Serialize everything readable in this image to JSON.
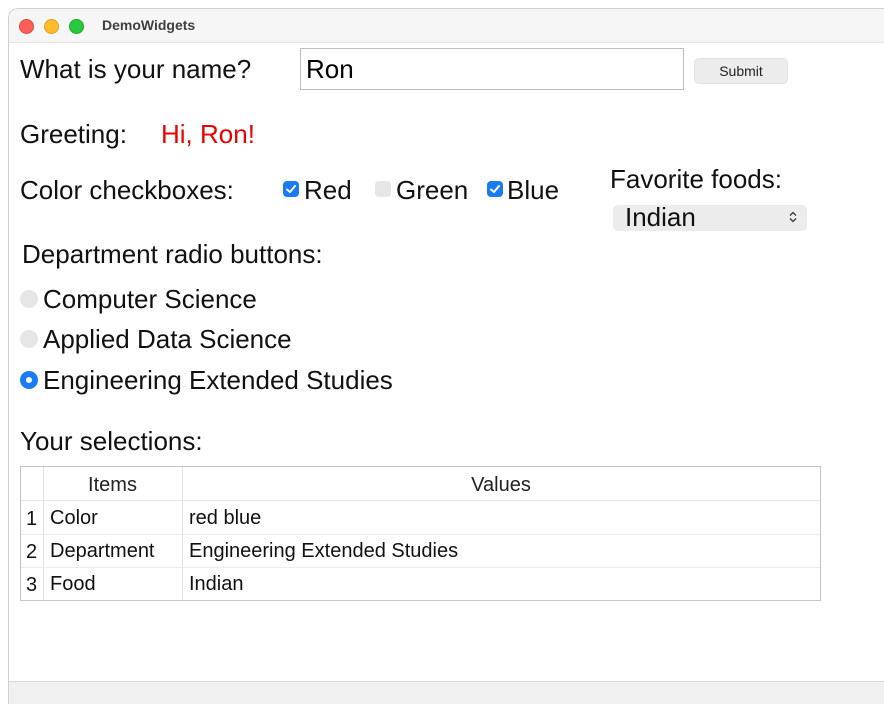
{
  "window": {
    "title": "DemoWidgets"
  },
  "name_row": {
    "label": "What is your name?",
    "input_value": "Ron",
    "submit_label": "Submit"
  },
  "greeting": {
    "label": "Greeting:",
    "value": "Hi, Ron!",
    "value_color": "#ee0000"
  },
  "colors": {
    "label": "Color checkboxes:",
    "options": [
      {
        "label": "Red",
        "checked": true
      },
      {
        "label": "Green",
        "checked": false
      },
      {
        "label": "Blue",
        "checked": true
      }
    ]
  },
  "foods": {
    "label": "Favorite foods:",
    "selected": "Indian"
  },
  "department": {
    "label": "Department radio buttons:",
    "options": [
      {
        "label": "Computer Science",
        "selected": false
      },
      {
        "label": "Applied Data Science",
        "selected": false
      },
      {
        "label": "Engineering Extended Studies",
        "selected": true
      }
    ]
  },
  "selections": {
    "label": "Your selections:",
    "headers": [
      "Items",
      "Values"
    ],
    "rows": [
      {
        "index": "1",
        "item": "Color",
        "value": "red blue"
      },
      {
        "index": "2",
        "item": "Department",
        "value": "Engineering Extended Studies"
      },
      {
        "index": "3",
        "item": "Food",
        "value": "Indian"
      }
    ]
  },
  "theme": {
    "accent": "#1a7cf5",
    "control_bg": "#ececec"
  }
}
